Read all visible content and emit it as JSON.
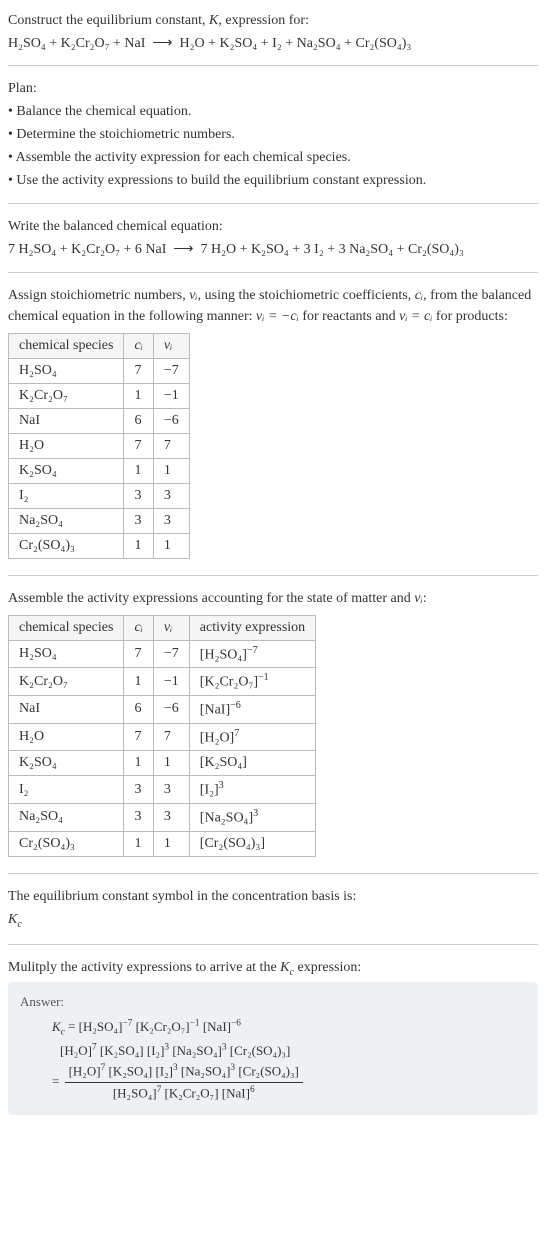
{
  "intro": {
    "title_prefix": "Construct the equilibrium constant, ",
    "K": "K",
    "title_suffix": ", expression for:",
    "reaction_left": "H₂SO₄ + K₂Cr₂O₇ + NaI",
    "arrow": "⟶",
    "reaction_right": "H₂O + K₂SO₄ + I₂ + Na₂SO₄ + Cr₂(SO₄)₃"
  },
  "plan": {
    "heading": "Plan:",
    "items": [
      "• Balance the chemical equation.",
      "• Determine the stoichiometric numbers.",
      "• Assemble the activity expression for each chemical species.",
      "• Use the activity expressions to build the equilibrium constant expression."
    ]
  },
  "balanced": {
    "heading": "Write the balanced chemical equation:",
    "left": "7 H₂SO₄ + K₂Cr₂O₇ + 6 NaI",
    "arrow": "⟶",
    "right": "7 H₂O + K₂SO₄ + 3 I₂ + 3 Na₂SO₄ + Cr₂(SO₄)₃"
  },
  "stoich_intro": {
    "p1a": "Assign stoichiometric numbers, ",
    "nu_i": "νᵢ",
    "p1b": ", using the stoichiometric coefficients, ",
    "c_i": "cᵢ",
    "p1c": ", from the balanced chemical equation in the following manner: ",
    "eq1": "νᵢ = −cᵢ",
    "p1d": " for reactants and ",
    "eq2": "νᵢ = cᵢ",
    "p1e": " for products:"
  },
  "stoich_table": {
    "headers": [
      "chemical species",
      "cᵢ",
      "νᵢ"
    ],
    "rows": [
      {
        "sp": "H₂SO₄",
        "c": "7",
        "v": "−7"
      },
      {
        "sp": "K₂Cr₂O₇",
        "c": "1",
        "v": "−1"
      },
      {
        "sp": "NaI",
        "c": "6",
        "v": "−6"
      },
      {
        "sp": "H₂O",
        "c": "7",
        "v": "7"
      },
      {
        "sp": "K₂SO₄",
        "c": "1",
        "v": "1"
      },
      {
        "sp": "I₂",
        "c": "3",
        "v": "3"
      },
      {
        "sp": "Na₂SO₄",
        "c": "3",
        "v": "3"
      },
      {
        "sp": "Cr₂(SO₄)₃",
        "c": "1",
        "v": "1"
      }
    ]
  },
  "activity_intro": {
    "text_a": "Assemble the activity expressions accounting for the state of matter and ",
    "nu_i": "νᵢ",
    "text_b": ":"
  },
  "activity_table": {
    "headers": [
      "chemical species",
      "cᵢ",
      "νᵢ",
      "activity expression"
    ],
    "rows": [
      {
        "sp": "H₂SO₄",
        "c": "7",
        "v": "−7",
        "a_base": "[H₂SO₄]",
        "a_exp": "−7"
      },
      {
        "sp": "K₂Cr₂O₇",
        "c": "1",
        "v": "−1",
        "a_base": "[K₂Cr₂O₇]",
        "a_exp": "−1"
      },
      {
        "sp": "NaI",
        "c": "6",
        "v": "−6",
        "a_base": "[NaI]",
        "a_exp": "−6"
      },
      {
        "sp": "H₂O",
        "c": "7",
        "v": "7",
        "a_base": "[H₂O]",
        "a_exp": "7"
      },
      {
        "sp": "K₂SO₄",
        "c": "1",
        "v": "1",
        "a_base": "[K₂SO₄]",
        "a_exp": ""
      },
      {
        "sp": "I₂",
        "c": "3",
        "v": "3",
        "a_base": "[I₂]",
        "a_exp": "3"
      },
      {
        "sp": "Na₂SO₄",
        "c": "3",
        "v": "3",
        "a_base": "[Na₂SO₄]",
        "a_exp": "3"
      },
      {
        "sp": "Cr₂(SO₄)₃",
        "c": "1",
        "v": "1",
        "a_base": "[Cr₂(SO₄)₃]",
        "a_exp": ""
      }
    ]
  },
  "symbol_section": {
    "line1": "The equilibrium constant symbol in the concentration basis is:",
    "Kc": "K_c"
  },
  "multiply_section": {
    "line_a": "Mulitply the activity expressions to arrive at the ",
    "Kc": "K_c",
    "line_b": " expression:"
  },
  "answer": {
    "label": "Answer:",
    "Kc_eq": "K_c",
    "line1_parts": [
      {
        "b": "[H₂SO₄]",
        "e": "−7"
      },
      {
        "b": "[K₂Cr₂O₇]",
        "e": "−1"
      },
      {
        "b": "[NaI]",
        "e": "−6"
      }
    ],
    "line2_parts": [
      {
        "b": "[H₂O]",
        "e": "7"
      },
      {
        "b": "[K₂SO₄]",
        "e": ""
      },
      {
        "b": "[I₂]",
        "e": "3"
      },
      {
        "b": "[Na₂SO₄]",
        "e": "3"
      },
      {
        "b": "[Cr₂(SO₄)₃]",
        "e": ""
      }
    ],
    "frac_num": [
      {
        "b": "[H₂O]",
        "e": "7"
      },
      {
        "b": "[K₂SO₄]",
        "e": ""
      },
      {
        "b": "[I₂]",
        "e": "3"
      },
      {
        "b": "[Na₂SO₄]",
        "e": "3"
      },
      {
        "b": "[Cr₂(SO₄)₃]",
        "e": ""
      }
    ],
    "frac_den": [
      {
        "b": "[H₂SO₄]",
        "e": "7"
      },
      {
        "b": "[K₂Cr₂O₇]",
        "e": ""
      },
      {
        "b": "[NaI]",
        "e": "6"
      }
    ]
  }
}
